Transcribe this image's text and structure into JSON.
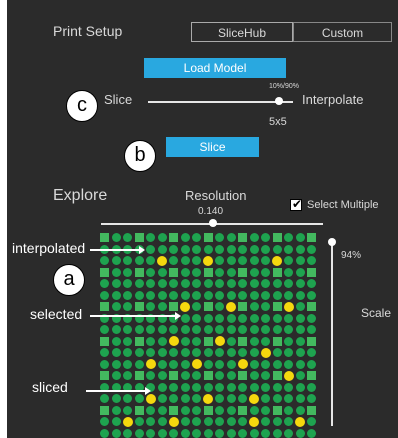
{
  "header": {
    "title": "Print Setup",
    "tabs": [
      "SliceHub",
      "Custom"
    ]
  },
  "load_model": {
    "label": "Load Model"
  },
  "slice_slider": {
    "left_label": "Slice",
    "right_label": "Interpolate",
    "value_label": "10%/90%",
    "value": 0.9
  },
  "grid_size": {
    "label": "5x5"
  },
  "slice_button": {
    "label": "Slice"
  },
  "explore": {
    "title": "Explore",
    "resolution_label": "Resolution",
    "resolution_value": "0.140",
    "select_multiple_label": "Select Multiple",
    "select_multiple_checked": true,
    "scale_label": "Scale",
    "scale_value": "94%"
  },
  "callouts": {
    "a": "a",
    "b": "b",
    "c": "c"
  },
  "annotations": {
    "interpolated": "interpolated",
    "selected": "selected",
    "sliced": "sliced"
  },
  "grid": {
    "rows": 18,
    "cols": 19,
    "legend_colors": {
      "interpolated": "#1ea34f",
      "sliced": "#43b95f",
      "selected": "#f5d80e"
    },
    "selected_cells": [
      [
        2,
        5
      ],
      [
        2,
        9
      ],
      [
        2,
        15
      ],
      [
        6,
        7
      ],
      [
        6,
        11
      ],
      [
        6,
        16
      ],
      [
        9,
        6
      ],
      [
        9,
        10
      ],
      [
        10,
        14
      ],
      [
        11,
        4
      ],
      [
        11,
        8
      ],
      [
        11,
        12
      ],
      [
        12,
        16
      ],
      [
        14,
        4
      ],
      [
        14,
        9
      ],
      [
        14,
        13
      ],
      [
        16,
        2
      ],
      [
        16,
        6
      ],
      [
        16,
        13
      ],
      [
        16,
        17
      ]
    ],
    "square_rows": [
      0,
      3,
      6,
      9,
      12,
      15
    ],
    "square_cols": [
      0,
      3,
      6,
      9,
      12,
      15,
      18
    ]
  }
}
